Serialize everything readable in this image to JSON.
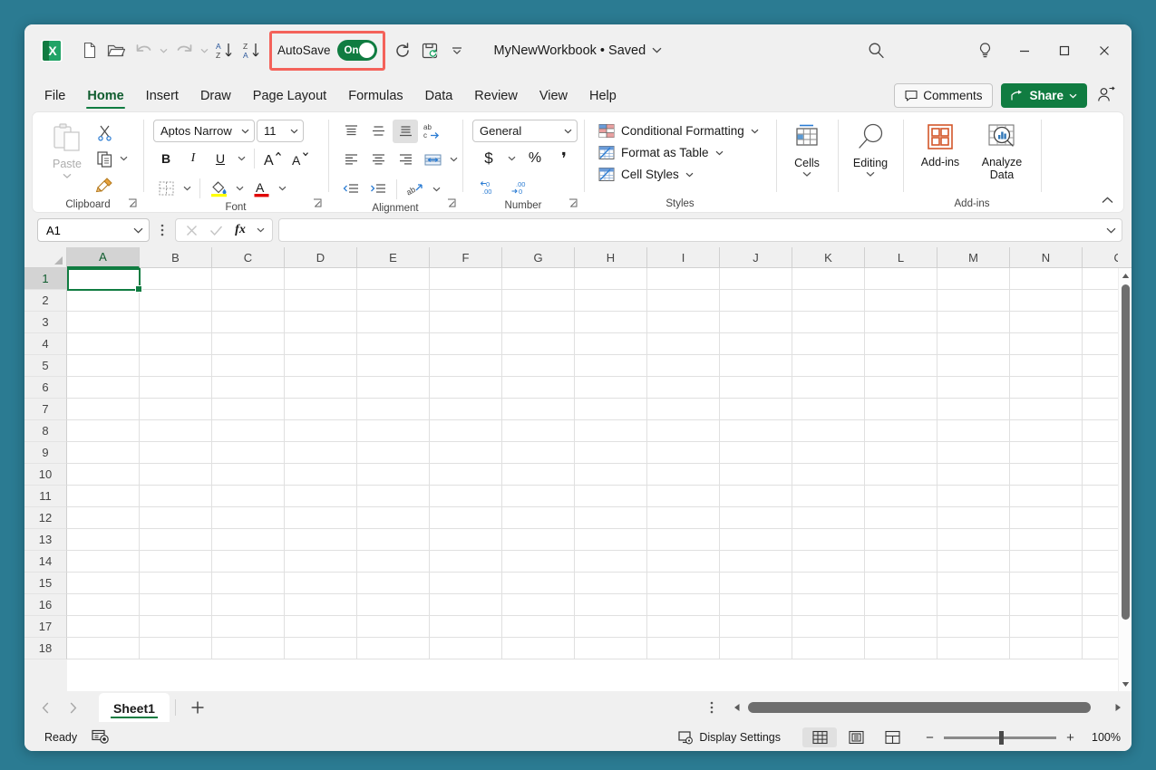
{
  "window": {
    "background_color": "#2b7b92",
    "surface_color": "#f0f0f0"
  },
  "titlebar": {
    "app_logo_letter": "X",
    "quick_access": [
      {
        "name": "new-file",
        "label": "New"
      },
      {
        "name": "open-file",
        "label": "Open"
      },
      {
        "name": "undo",
        "label": "Undo"
      },
      {
        "name": "redo",
        "label": "Redo"
      },
      {
        "name": "sort-ascending",
        "label": "Sort A to Z"
      },
      {
        "name": "sort-descending",
        "label": "Sort Z to A"
      }
    ],
    "autosave": {
      "label": "AutoSave",
      "state": "On",
      "toggle_color": "#107c41",
      "highlight_color": "#f4625a",
      "highlighted": true
    },
    "refresh_label": "Refresh",
    "save_label": "Save",
    "qat_more_label": "Customize Quick Access Toolbar",
    "document_title": "MyNewWorkbook • Saved",
    "search_label": "Search",
    "ideas_label": "Ideas",
    "minimize_label": "Minimize",
    "maximize_label": "Maximize",
    "close_label": "Close"
  },
  "ribbon_tabs": {
    "items": [
      {
        "label": "File",
        "active": false
      },
      {
        "label": "Home",
        "active": true
      },
      {
        "label": "Insert",
        "active": false
      },
      {
        "label": "Draw",
        "active": false
      },
      {
        "label": "Page Layout",
        "active": false
      },
      {
        "label": "Formulas",
        "active": false
      },
      {
        "label": "Data",
        "active": false
      },
      {
        "label": "Review",
        "active": false
      },
      {
        "label": "View",
        "active": false
      },
      {
        "label": "Help",
        "active": false
      }
    ],
    "comments_label": "Comments",
    "share_label": "Share",
    "share_color": "#107c41",
    "active_underline_color": "#107c41"
  },
  "ribbon": {
    "clipboard": {
      "group_label": "Clipboard",
      "paste_label": "Paste",
      "paste_disabled": true,
      "cut_label": "Cut",
      "copy_label": "Copy",
      "format_painter_label": "Format Painter"
    },
    "font": {
      "group_label": "Font",
      "font_name": "Aptos Narrow",
      "font_size": "11",
      "bold_label": "B",
      "italic_label": "I",
      "underline_label": "U",
      "grow_font_label": "Increase Font Size",
      "shrink_font_label": "Decrease Font Size",
      "borders_label": "Borders",
      "fill_color_label": "Fill Color",
      "font_color_label": "Font Color",
      "fill_swatch_color": "#ffff00",
      "font_swatch_color": "#e00000"
    },
    "alignment": {
      "group_label": "Alignment",
      "top_align_label": "Top Align",
      "middle_align_label": "Middle Align",
      "bottom_align_label": "Bottom Align",
      "wrap_text_label": "Wrap Text",
      "align_left_label": "Align Left",
      "align_center_label": "Center",
      "align_right_label": "Align Right",
      "merge_label": "Merge & Center",
      "decrease_indent_label": "Decrease Indent",
      "increase_indent_label": "Increase Indent",
      "orientation_label": "Orientation"
    },
    "number": {
      "group_label": "Number",
      "format": "General",
      "accounting_label": "Accounting Number Format",
      "percent_label": "Percent Style",
      "comma_label": "Comma Style",
      "increase_decimal_label": "Increase Decimal",
      "decrease_decimal_label": "Decrease Decimal"
    },
    "styles": {
      "group_label": "Styles",
      "items": [
        {
          "label": "Conditional Formatting"
        },
        {
          "label": "Format as Table"
        },
        {
          "label": "Cell Styles"
        }
      ]
    },
    "cells": {
      "label": "Cells"
    },
    "editing": {
      "label": "Editing"
    },
    "addins": {
      "group_label": "Add-ins",
      "addins_label": "Add-ins",
      "analyze_label_line1": "Analyze",
      "analyze_label_line2": "Data",
      "addins_icon_color": "#d4572a"
    },
    "collapse_label": "Collapse the Ribbon"
  },
  "formula_bar": {
    "name_box_value": "A1",
    "cancel_label": "Cancel",
    "enter_label": "Enter",
    "fx_label": "fx",
    "formula_value": "",
    "expand_label": "Expand Formula Bar"
  },
  "grid": {
    "columns": [
      "A",
      "B",
      "C",
      "D",
      "E",
      "F",
      "G",
      "H",
      "I",
      "J",
      "K",
      "L",
      "M",
      "N",
      "O"
    ],
    "rows": [
      1,
      2,
      3,
      4,
      5,
      6,
      7,
      8,
      9,
      10,
      11,
      12,
      13,
      14,
      15,
      16,
      17,
      18
    ],
    "selected_cell": "A1",
    "selected_column": "A",
    "selected_row": 1,
    "selection_color": "#107c41",
    "cell_values": []
  },
  "sheet_bar": {
    "prev_label": "Previous Sheet",
    "next_label": "Next Sheet",
    "tabs": [
      {
        "label": "Sheet1",
        "active": true
      }
    ],
    "add_sheet_label": "New sheet",
    "all_sheets_label": "All Sheets"
  },
  "status_bar": {
    "mode": "Ready",
    "macro_label": "Record Macro",
    "display_settings_label": "Display Settings",
    "views": [
      {
        "name": "normal",
        "label": "Normal",
        "active": true
      },
      {
        "name": "page-layout",
        "label": "Page Layout",
        "active": false
      },
      {
        "name": "page-break-preview",
        "label": "Page Break Preview",
        "active": false
      }
    ],
    "zoom_out_label": "−",
    "zoom_in_label": "+",
    "zoom_level": "100%",
    "zoom_value": 100
  }
}
